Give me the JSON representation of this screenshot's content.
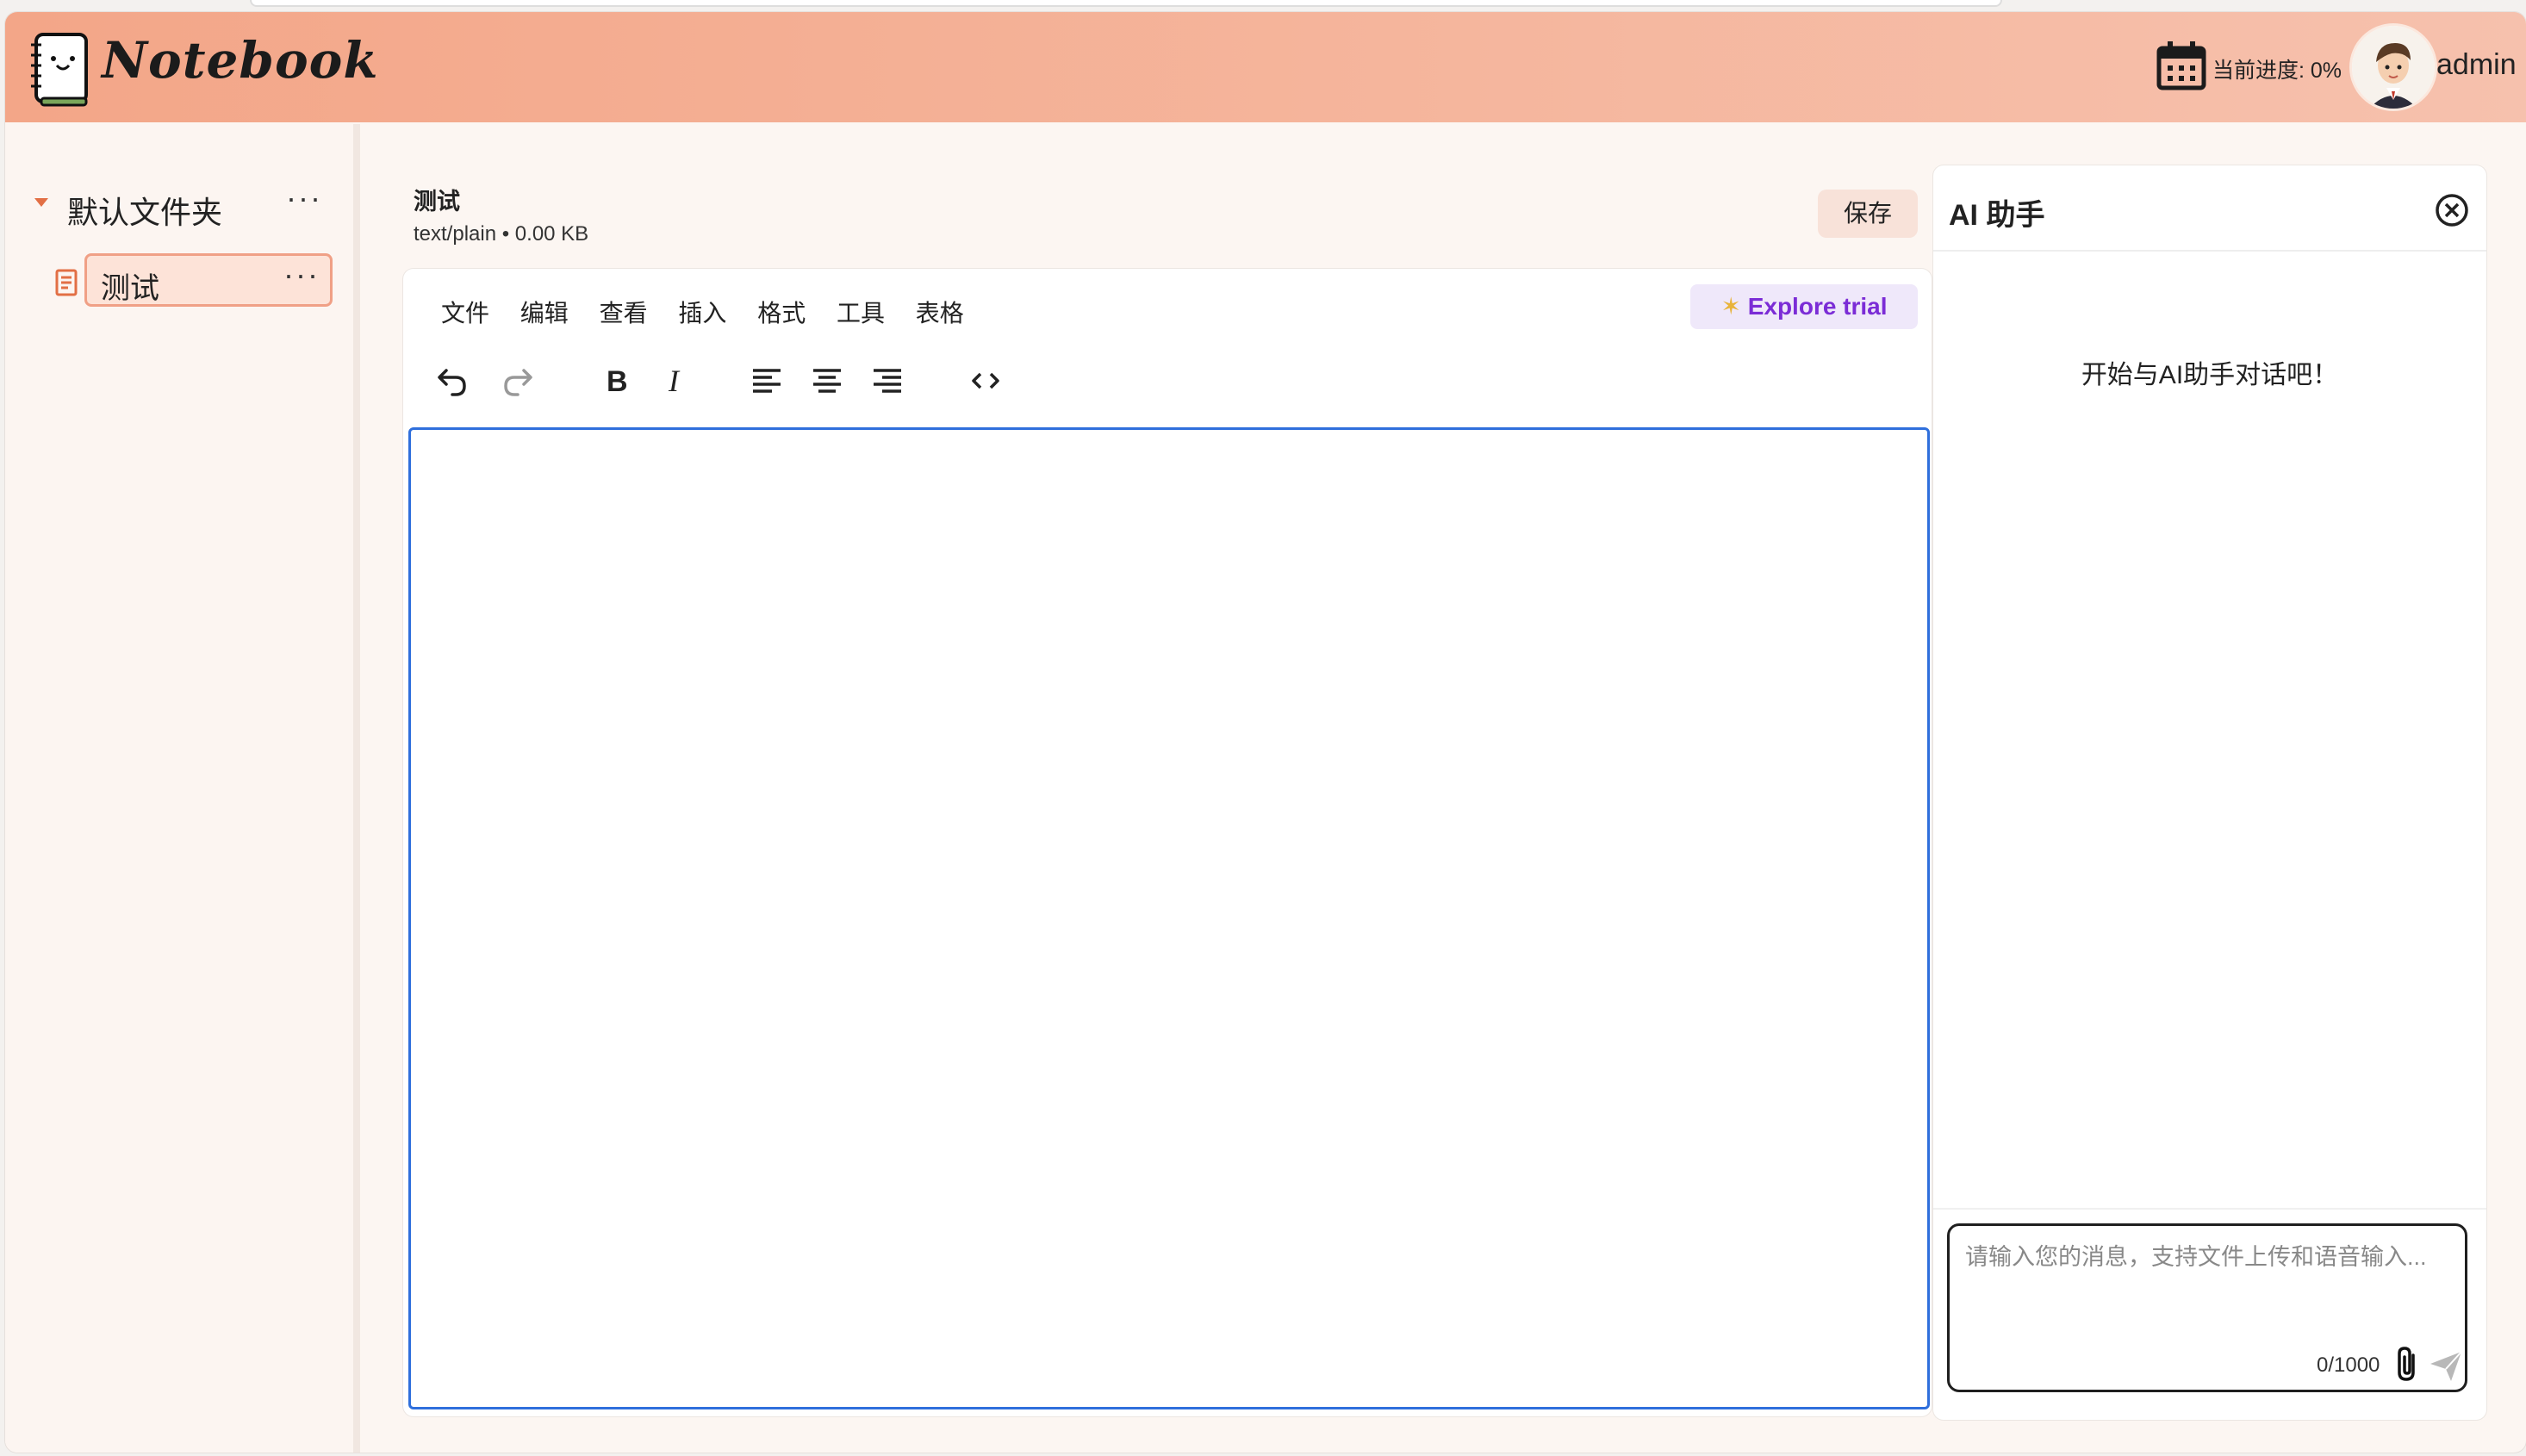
{
  "app": {
    "name": "Notebook"
  },
  "header": {
    "progress_text": "当前进度: 0%",
    "username": "admin"
  },
  "sidebar": {
    "folder": {
      "label": "默认文件夹",
      "more": "···"
    },
    "files": [
      {
        "label": "测试",
        "more": "···"
      }
    ]
  },
  "document": {
    "title": "测试",
    "meta": "text/plain • 0.00 KB",
    "save_label": "保存"
  },
  "editor": {
    "menus": [
      "文件",
      "编辑",
      "查看",
      "插入",
      "格式",
      "工具",
      "表格"
    ],
    "explore_label": "Explore trial",
    "toolbar_icons": [
      "undo-icon",
      "redo-icon",
      "bold-icon",
      "italic-icon",
      "align-left-icon",
      "align-center-icon",
      "align-right-icon",
      "code-icon"
    ]
  },
  "ai_panel": {
    "title": "AI 助手",
    "welcome": "开始与AI助手对话吧！",
    "input_placeholder": "请输入您的消息，支持文件上传和语音输入...",
    "char_count": "0/1000"
  },
  "colors": {
    "header_start": "#f3a688",
    "header_end": "#f6c1ad",
    "accent": "#e26f45",
    "editor_focus": "#2f6fdc",
    "explore_text": "#7b2cd6"
  }
}
